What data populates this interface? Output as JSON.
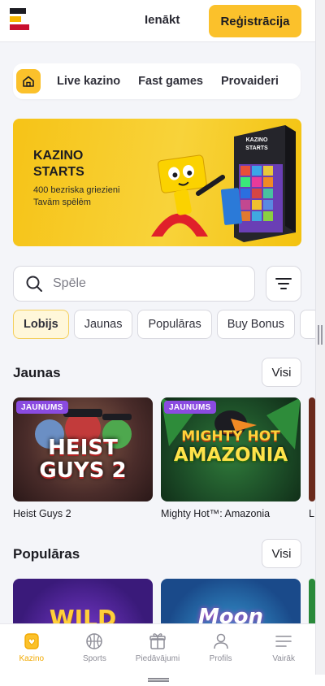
{
  "header": {
    "login_label": "Ienākt",
    "register_label": "Reģistrācija"
  },
  "tabs": [
    {
      "label": "Live kazino"
    },
    {
      "label": "Fast games"
    },
    {
      "label": "Provaideri"
    }
  ],
  "banner": {
    "title": "KAZINO\nSTARTS",
    "subtitle": "400 bezriska griezieni\nTavām spēlēm",
    "box_label": "KAZINO\nSTARTS"
  },
  "search": {
    "placeholder": "Spēle"
  },
  "chips": [
    {
      "label": "Lobijs",
      "active": true
    },
    {
      "label": "Jaunas"
    },
    {
      "label": "Populāras"
    },
    {
      "label": "Buy Bonus"
    }
  ],
  "sections": {
    "new": {
      "title": "Jaunas",
      "all_label": "Visi",
      "games": [
        {
          "name": "Heist Guys 2",
          "badge": "JAUNUMS",
          "art": "HEIST\nGUYS 2"
        },
        {
          "name": "Mighty Hot™: Amazonia",
          "badge": "JAUNUMS",
          "art_top": "MIGHTY HOT",
          "art_bottom": "AMAZONIA"
        },
        {
          "name": "L"
        }
      ]
    },
    "popular": {
      "title": "Populāras",
      "all_label": "Visi",
      "games": [
        {
          "art": "WILD"
        },
        {
          "art": "Moon"
        }
      ]
    }
  },
  "bottom_nav": [
    {
      "label": "Kazino",
      "icon": "casino-icon",
      "active": true
    },
    {
      "label": "Sports",
      "icon": "basketball-icon"
    },
    {
      "label": "Piedāvājumi",
      "icon": "gift-icon"
    },
    {
      "label": "Profils",
      "icon": "user-icon"
    },
    {
      "label": "Vairāk",
      "icon": "menu-icon"
    }
  ],
  "colors": {
    "accent": "#fbc12b",
    "badge": "#8a4be0",
    "nav_active": "#f2a900"
  }
}
